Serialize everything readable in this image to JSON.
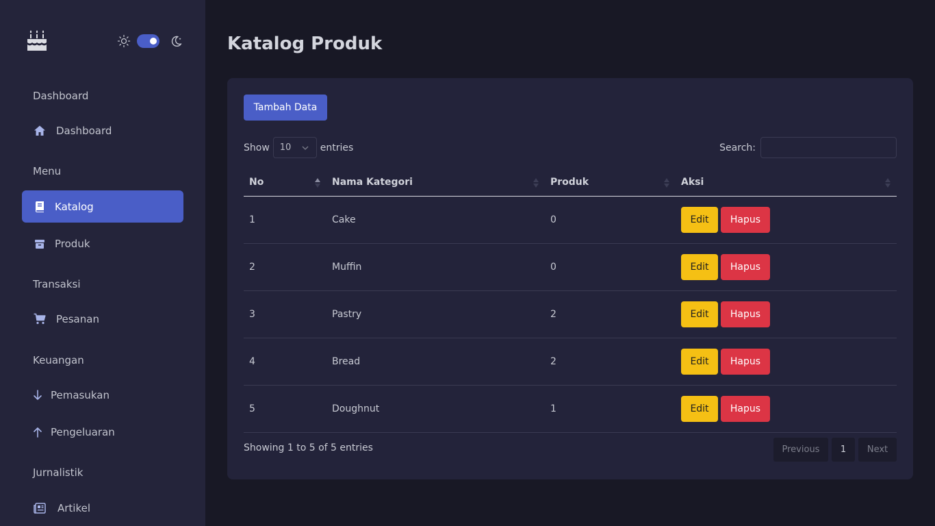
{
  "sidebar": {
    "sections": [
      {
        "heading": "Dashboard",
        "items": [
          {
            "label": "Dashboard",
            "icon": "home-icon"
          }
        ]
      },
      {
        "heading": "Menu",
        "items": [
          {
            "label": "Katalog",
            "icon": "book-icon",
            "active": true
          },
          {
            "label": "Produk",
            "icon": "box-icon"
          }
        ]
      },
      {
        "heading": "Transaksi",
        "items": [
          {
            "label": "Pesanan",
            "icon": "cart-icon"
          }
        ]
      },
      {
        "heading": "Keuangan",
        "items": [
          {
            "label": "Pemasukan",
            "icon": "arrow-down-icon"
          },
          {
            "label": "Pengeluaran",
            "icon": "arrow-up-icon"
          }
        ]
      },
      {
        "heading": "Jurnalistik",
        "items": [
          {
            "label": "Artikel",
            "icon": "newspaper-icon"
          }
        ]
      }
    ],
    "theme_toggle": {
      "dark_mode": true
    }
  },
  "page": {
    "title": "Katalog Produk"
  },
  "card": {
    "add_button": "Tambah Data",
    "length": {
      "show": "Show",
      "value": "10",
      "entries": "entries"
    },
    "search": {
      "label": "Search:",
      "value": ""
    },
    "table": {
      "headers": [
        "No",
        "Nama Kategori",
        "Produk",
        "Aksi"
      ],
      "rows": [
        {
          "no": "1",
          "name": "Cake",
          "produk": "0"
        },
        {
          "no": "2",
          "name": "Muffin",
          "produk": "0"
        },
        {
          "no": "3",
          "name": "Pastry",
          "produk": "2"
        },
        {
          "no": "4",
          "name": "Bread",
          "produk": "2"
        },
        {
          "no": "5",
          "name": "Doughnut",
          "produk": "1"
        }
      ],
      "edit_label": "Edit",
      "delete_label": "Hapus"
    },
    "info": "Showing 1 to 5 of 5 entries",
    "pagination": {
      "previous": "Previous",
      "page": "1",
      "next": "Next"
    }
  },
  "colors": {
    "accent": "#4a5ec7",
    "edit": "#f5c014",
    "delete": "#dc3545",
    "sidebar": "#24243a",
    "background": "#181825"
  }
}
